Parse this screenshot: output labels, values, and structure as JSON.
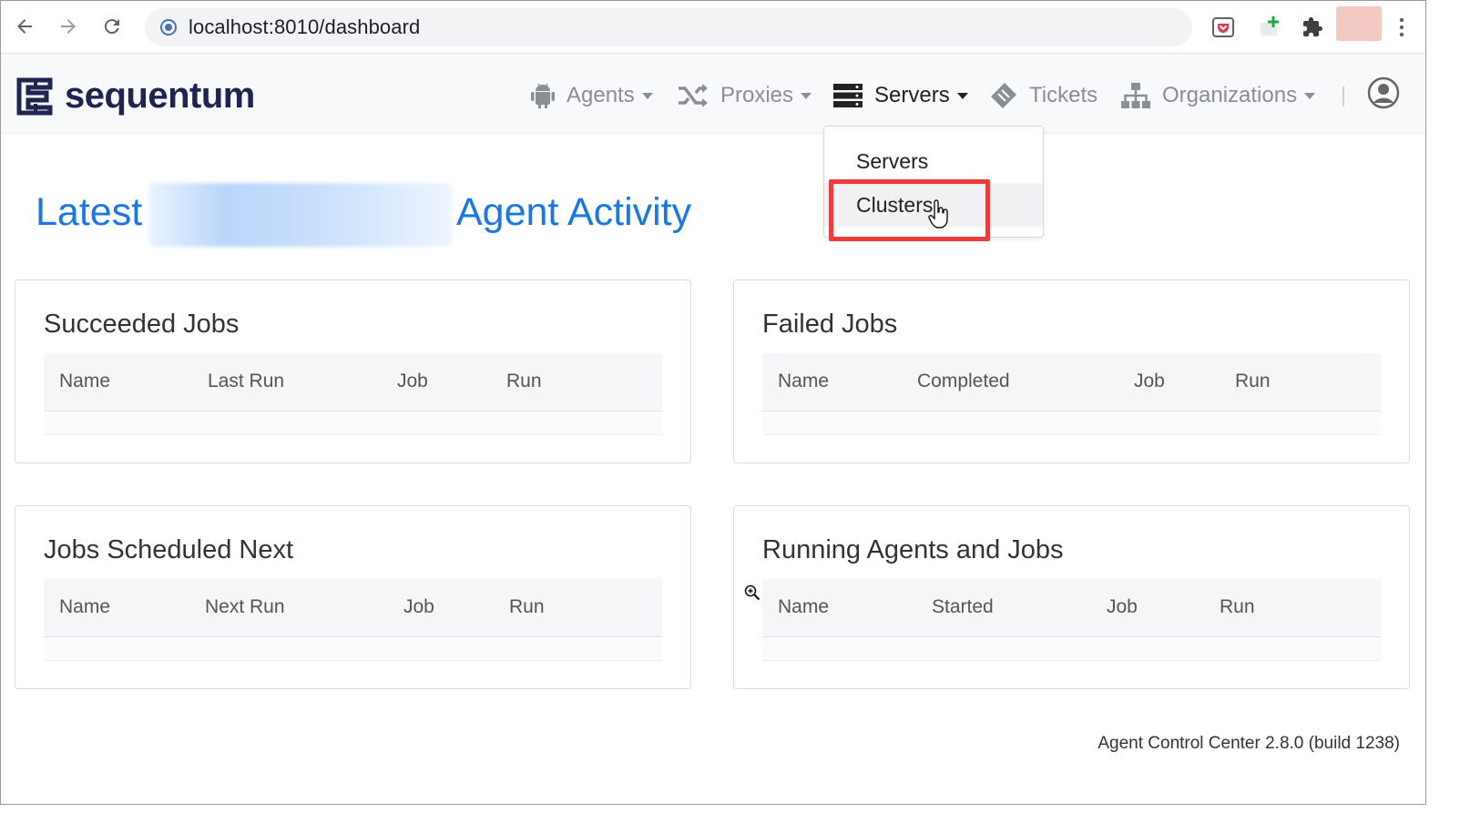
{
  "browser": {
    "url": "localhost:8010/dashboard"
  },
  "app": {
    "brand": "sequentum",
    "nav": [
      {
        "label": "Agents",
        "icon": "android-icon",
        "has_caret": true
      },
      {
        "label": "Proxies",
        "icon": "shuffle-icon",
        "has_caret": true
      },
      {
        "label": "Servers",
        "icon": "server-icon",
        "has_caret": true,
        "active": true
      },
      {
        "label": "Tickets",
        "icon": "ticket-icon",
        "has_caret": false
      },
      {
        "label": "Organizations",
        "icon": "sitemap-icon",
        "has_caret": true
      }
    ],
    "user_icon": "user-circle-icon"
  },
  "dropdown": {
    "items": [
      "Servers",
      "Clusters"
    ],
    "hovered": "Clusters"
  },
  "headline": {
    "prefix": "Latest",
    "suffix": "Agent Activity"
  },
  "cards": [
    {
      "title": "Succeeded Jobs",
      "columns": [
        "Name",
        "Last Run",
        "Job",
        "Run"
      ]
    },
    {
      "title": "Failed Jobs",
      "columns": [
        "Name",
        "Completed",
        "Job",
        "Run"
      ]
    },
    {
      "title": "Jobs Scheduled Next",
      "columns": [
        "Name",
        "Next Run",
        "Job",
        "Run"
      ]
    },
    {
      "title": "Running Agents and Jobs",
      "columns": [
        "Name",
        "Started",
        "Job",
        "Run"
      ]
    }
  ],
  "footer": "Agent Control Center 2.8.0 (build 1238)",
  "colors": {
    "accent": "#1a78e5",
    "brand": "#1d2550",
    "highlight": "#ee3b3b"
  }
}
